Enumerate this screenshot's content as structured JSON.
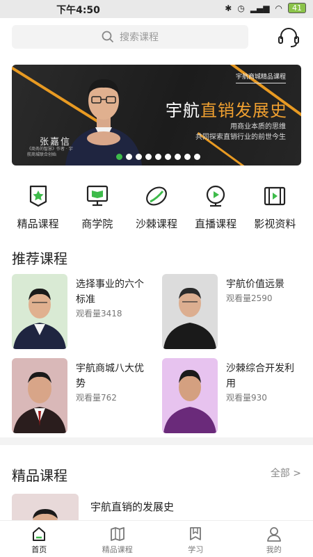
{
  "status": {
    "time": "下午4:50",
    "battery": "41"
  },
  "search": {
    "placeholder": "搜索课程"
  },
  "banner": {
    "tag": "宇航商城精品课程",
    "title_prefix": "宇航",
    "title_highlight": "直销发展史",
    "subtitle1": "用商业本质的思维",
    "subtitle2": "共同探索直销行业的前世今生",
    "name": "张嘉信",
    "bio": "《商务的智慧》作者 · 宇航商城联合创始",
    "slides": 9,
    "active_slide": 0
  },
  "categories": [
    {
      "label": "精品课程",
      "icon": "star-badge-icon"
    },
    {
      "label": "商学院",
      "icon": "book-monitor-icon"
    },
    {
      "label": "沙棘课程",
      "icon": "leaf-icon"
    },
    {
      "label": "直播课程",
      "icon": "live-play-icon"
    },
    {
      "label": "影视资料",
      "icon": "film-icon"
    }
  ],
  "recommended": {
    "heading": "推荐课程",
    "items": [
      {
        "title": "选择事业的六个标准",
        "views": "观看量3418"
      },
      {
        "title": "宇航价值远景",
        "views": "观看量2590"
      },
      {
        "title": "宇航商城八大优势",
        "views": "观看量762"
      },
      {
        "title": "沙棘综合开发利用",
        "views": "观看量930"
      }
    ]
  },
  "premium": {
    "heading": "精品课程",
    "more": "全部 >",
    "items": [
      {
        "title": "宇航直销的发展史"
      }
    ]
  },
  "tabs": [
    {
      "label": "首页",
      "icon": "home-icon"
    },
    {
      "label": "精品课程",
      "icon": "map-book-icon"
    },
    {
      "label": "学习",
      "icon": "bookmark-icon"
    },
    {
      "label": "我的",
      "icon": "user-icon"
    }
  ],
  "colors": {
    "accent": "#3dbb4a",
    "banner_highlight": "#f0a030"
  }
}
